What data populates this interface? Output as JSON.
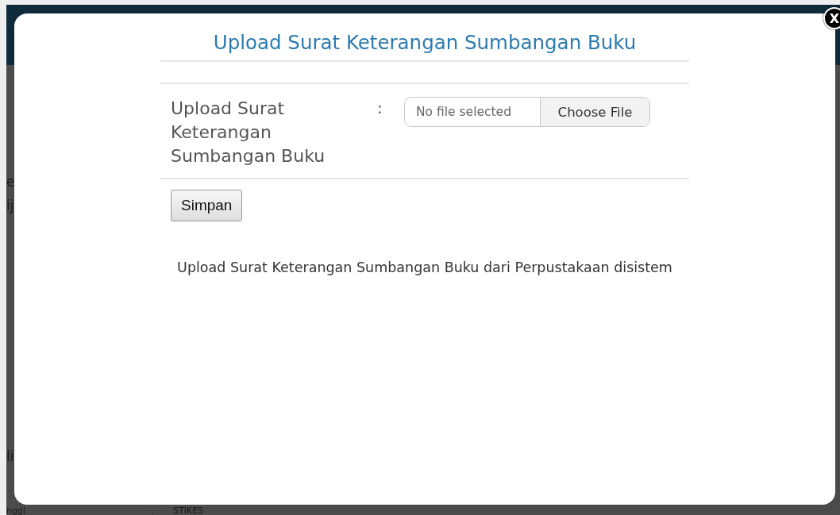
{
  "background_page": {
    "fragments": [
      {
        "text": "e"
      },
      {
        "text": "ij"
      },
      {
        "text": "li"
      },
      {
        "text": "nggi",
        "separator": ":",
        "value": "STIKES"
      }
    ]
  },
  "dialog": {
    "title": "Upload Surat Keterangan Sumbangan Buku",
    "close_label": "X",
    "field": {
      "label": "Upload Surat Keterangan Sumbangan Buku",
      "separator": ":",
      "placeholder": "No file selected",
      "button": "Choose File"
    },
    "submit": "Simpan",
    "description": "Upload Surat Keterangan Sumbangan Buku dari Perpustakaan disistem"
  }
}
